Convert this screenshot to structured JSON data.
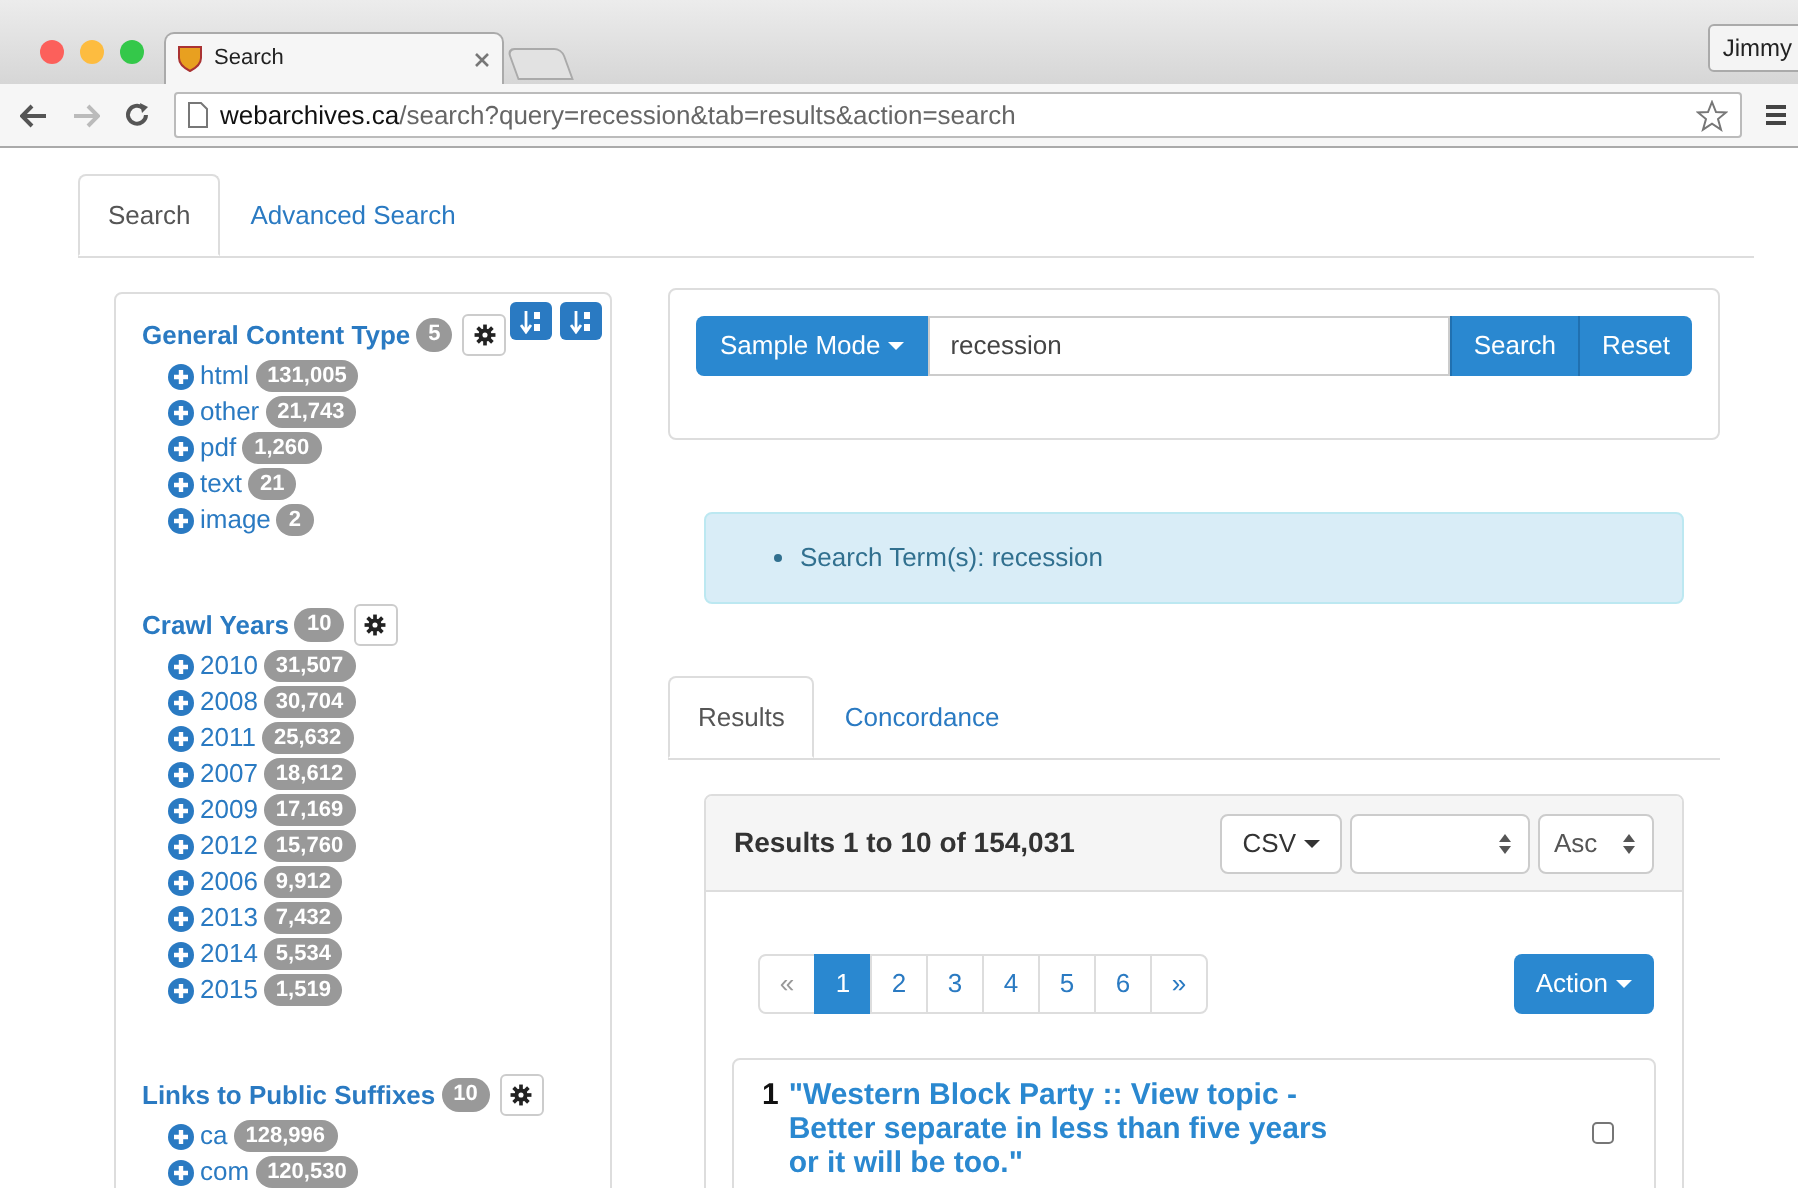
{
  "browser": {
    "tab_title": "Search",
    "user_button": "Jimmy",
    "url_host": "webarchives.ca",
    "url_path": "/search?query=recession&tab=results&action=search"
  },
  "page_tabs": [
    {
      "label": "Search",
      "selected": true
    },
    {
      "label": "Advanced Search",
      "selected": false
    }
  ],
  "facets": [
    {
      "title": "General Content Type",
      "count": "5",
      "items": [
        {
          "label": "html",
          "count": "131,005"
        },
        {
          "label": "other",
          "count": "21,743"
        },
        {
          "label": "pdf",
          "count": "1,260"
        },
        {
          "label": "text",
          "count": "21"
        },
        {
          "label": "image",
          "count": "2"
        }
      ]
    },
    {
      "title": "Crawl Years",
      "count": "10",
      "items": [
        {
          "label": "2010",
          "count": "31,507"
        },
        {
          "label": "2008",
          "count": "30,704"
        },
        {
          "label": "2011",
          "count": "25,632"
        },
        {
          "label": "2007",
          "count": "18,612"
        },
        {
          "label": "2009",
          "count": "17,169"
        },
        {
          "label": "2012",
          "count": "15,760"
        },
        {
          "label": "2006",
          "count": "9,912"
        },
        {
          "label": "2013",
          "count": "7,432"
        },
        {
          "label": "2014",
          "count": "5,534"
        },
        {
          "label": "2015",
          "count": "1,519"
        }
      ]
    },
    {
      "title": "Links to Public Suffixes",
      "count": "10",
      "items": [
        {
          "label": "ca",
          "count": "128,996"
        },
        {
          "label": "com",
          "count": "120,530"
        }
      ]
    }
  ],
  "search": {
    "mode_button": "Sample Mode",
    "value": "recession",
    "buttons": [
      "Search",
      "Reset"
    ]
  },
  "alert": {
    "items": [
      "Search Term(s): recession"
    ]
  },
  "result_tabs": [
    {
      "label": "Results",
      "selected": true
    },
    {
      "label": "Concordance",
      "selected": false
    }
  ],
  "results": {
    "summary": "Results 1 to 10 of 154,031",
    "export_button": "CSV",
    "sort_order": "Asc",
    "action_button": "Action",
    "pagination": [
      {
        "label": "«",
        "selected": false,
        "disabled": true
      },
      {
        "label": "1",
        "selected": true,
        "disabled": false
      },
      {
        "label": "2",
        "selected": false,
        "disabled": false
      },
      {
        "label": "3",
        "selected": false,
        "disabled": false
      },
      {
        "label": "4",
        "selected": false,
        "disabled": false
      },
      {
        "label": "5",
        "selected": false,
        "disabled": false
      },
      {
        "label": "6",
        "selected": false,
        "disabled": false
      },
      {
        "label": "»",
        "selected": false,
        "disabled": false
      }
    ],
    "items": [
      {
        "number": "1",
        "title": "\"Western Block Party :: View topic - Better separate in less than five years or it will be too.\"",
        "checked": false
      }
    ]
  }
}
